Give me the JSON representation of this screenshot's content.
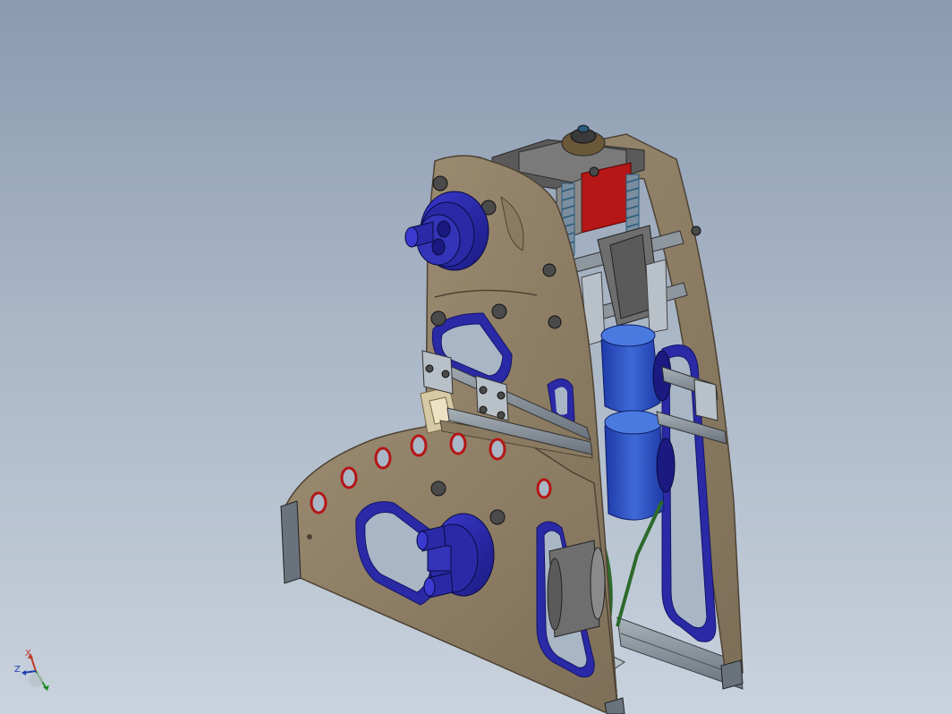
{
  "viewport": {
    "background_top": "#8b9ab0",
    "background_bottom": "#c9d2dd"
  },
  "model": {
    "plate_color": "#8a7a62",
    "plate_edge_color": "#4d4334",
    "motor_color": "#2a2aa6",
    "belt_color": "#2c6a2c",
    "accent_red": "#b51616",
    "rail_color": "#8e969e"
  },
  "triad": {
    "x_label": "X",
    "z_label": "Z",
    "x_color": "#c0392b",
    "y_color": "#1e8c2e",
    "z_color": "#1f3fb0"
  }
}
